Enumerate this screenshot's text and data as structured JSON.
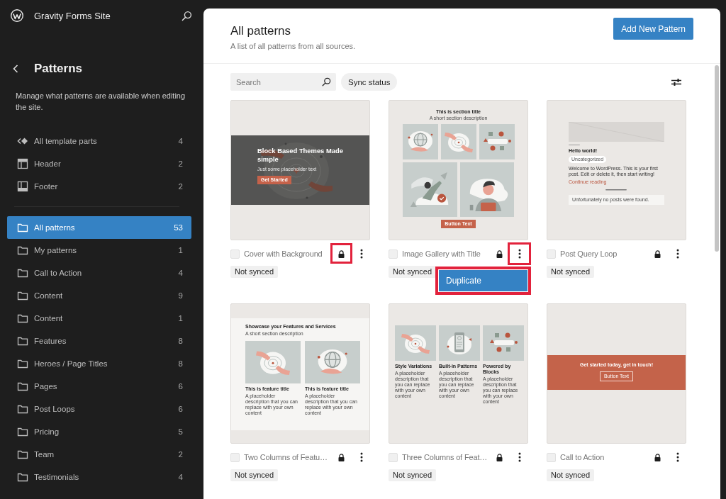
{
  "sidebar": {
    "site_title": "Gravity Forms Site",
    "title": "Patterns",
    "description": "Manage what patterns are available when editing the site.",
    "template_parts": [
      {
        "kind": "all",
        "label": "All template parts",
        "count": "4",
        "selected": false
      },
      {
        "kind": "header",
        "label": "Header",
        "count": "2",
        "selected": false
      },
      {
        "kind": "footer",
        "label": "Footer",
        "count": "2",
        "selected": false
      }
    ],
    "categories": [
      {
        "label": "All patterns",
        "count": "53",
        "selected": true
      },
      {
        "label": "My patterns",
        "count": "1",
        "selected": false
      },
      {
        "label": "Call to Action",
        "count": "4",
        "selected": false
      },
      {
        "label": "Content",
        "count": "9",
        "selected": false
      },
      {
        "label": "Content",
        "count": "1",
        "selected": false
      },
      {
        "label": "Features",
        "count": "8",
        "selected": false
      },
      {
        "label": "Heroes / Page Titles",
        "count": "8",
        "selected": false
      },
      {
        "label": "Pages",
        "count": "6",
        "selected": false
      },
      {
        "label": "Post Loops",
        "count": "6",
        "selected": false
      },
      {
        "label": "Pricing",
        "count": "5",
        "selected": false
      },
      {
        "label": "Team",
        "count": "2",
        "selected": false
      },
      {
        "label": "Testimonials",
        "count": "4",
        "selected": false
      }
    ]
  },
  "main": {
    "title": "All patterns",
    "subtitle": "A list of all patterns from all sources.",
    "add_button": "Add New Pattern",
    "search": {
      "placeholder": "Search"
    },
    "sync_filter": "Sync status",
    "patterns": [
      {
        "title": "Cover with Background",
        "status": "Not synced",
        "checked": false,
        "locked": true,
        "lock_highlighted": true,
        "menu_highlighted": false,
        "preview": {
          "kind": "cover",
          "heading": "Block Based Themes Made simple",
          "text": "Just some placeholder text",
          "button": "Get Started"
        }
      },
      {
        "title": "Image Gallery with Title",
        "status": "Not synced",
        "checked": false,
        "locked": true,
        "lock_highlighted": false,
        "menu_highlighted": true,
        "dropdown": {
          "highlighted": true,
          "items": [
            {
              "label": "Duplicate",
              "selected": true
            }
          ]
        },
        "preview": {
          "kind": "gallery",
          "heading": "This is section title",
          "text": "A short section description",
          "button": "Button Text"
        }
      },
      {
        "title": "Post Query Loop",
        "status": "Not synced",
        "checked": false,
        "locked": true,
        "lock_highlighted": false,
        "menu_highlighted": false,
        "preview": {
          "kind": "query",
          "heading": "Hello world!",
          "category": "Uncategorized",
          "text": "Welcome to WordPress. This is your first post. Edit or delete it, then start writing!",
          "link": "Continue reading",
          "notice": "Unfortunately no posts were found."
        }
      },
      {
        "title": "Two Columns of Featu…",
        "status": "Not synced",
        "checked": false,
        "locked": true,
        "lock_highlighted": false,
        "menu_highlighted": false,
        "preview": {
          "kind": "two-columns",
          "heading": "Showcase your Features and Services",
          "text": "A short section description",
          "columns": [
            {
              "title": "This is feature title",
              "text": "A placeholder description that you can replace with your own content"
            },
            {
              "title": "This is feature title",
              "text": "A placeholder description that you can replace with your own content"
            }
          ]
        }
      },
      {
        "title": "Three Columns of Feat…",
        "status": "Not synced",
        "checked": false,
        "locked": true,
        "lock_highlighted": false,
        "menu_highlighted": false,
        "preview": {
          "kind": "three-columns",
          "columns": [
            {
              "title": "Style Variations",
              "text": "A placeholder description that you can replace with your own content"
            },
            {
              "title": "Built-in Patterns",
              "text": "A placeholder description that you can replace with your own content"
            },
            {
              "title": "Powered by Blocks",
              "text": "A placeholder description that you can replace with your own content"
            }
          ]
        }
      },
      {
        "title": "Call to Action",
        "status": "Not synced",
        "checked": false,
        "locked": true,
        "lock_highlighted": false,
        "menu_highlighted": false,
        "preview": {
          "kind": "cta",
          "heading": "Get started today, get in touch!",
          "button": "Button Text"
        }
      }
    ]
  }
}
